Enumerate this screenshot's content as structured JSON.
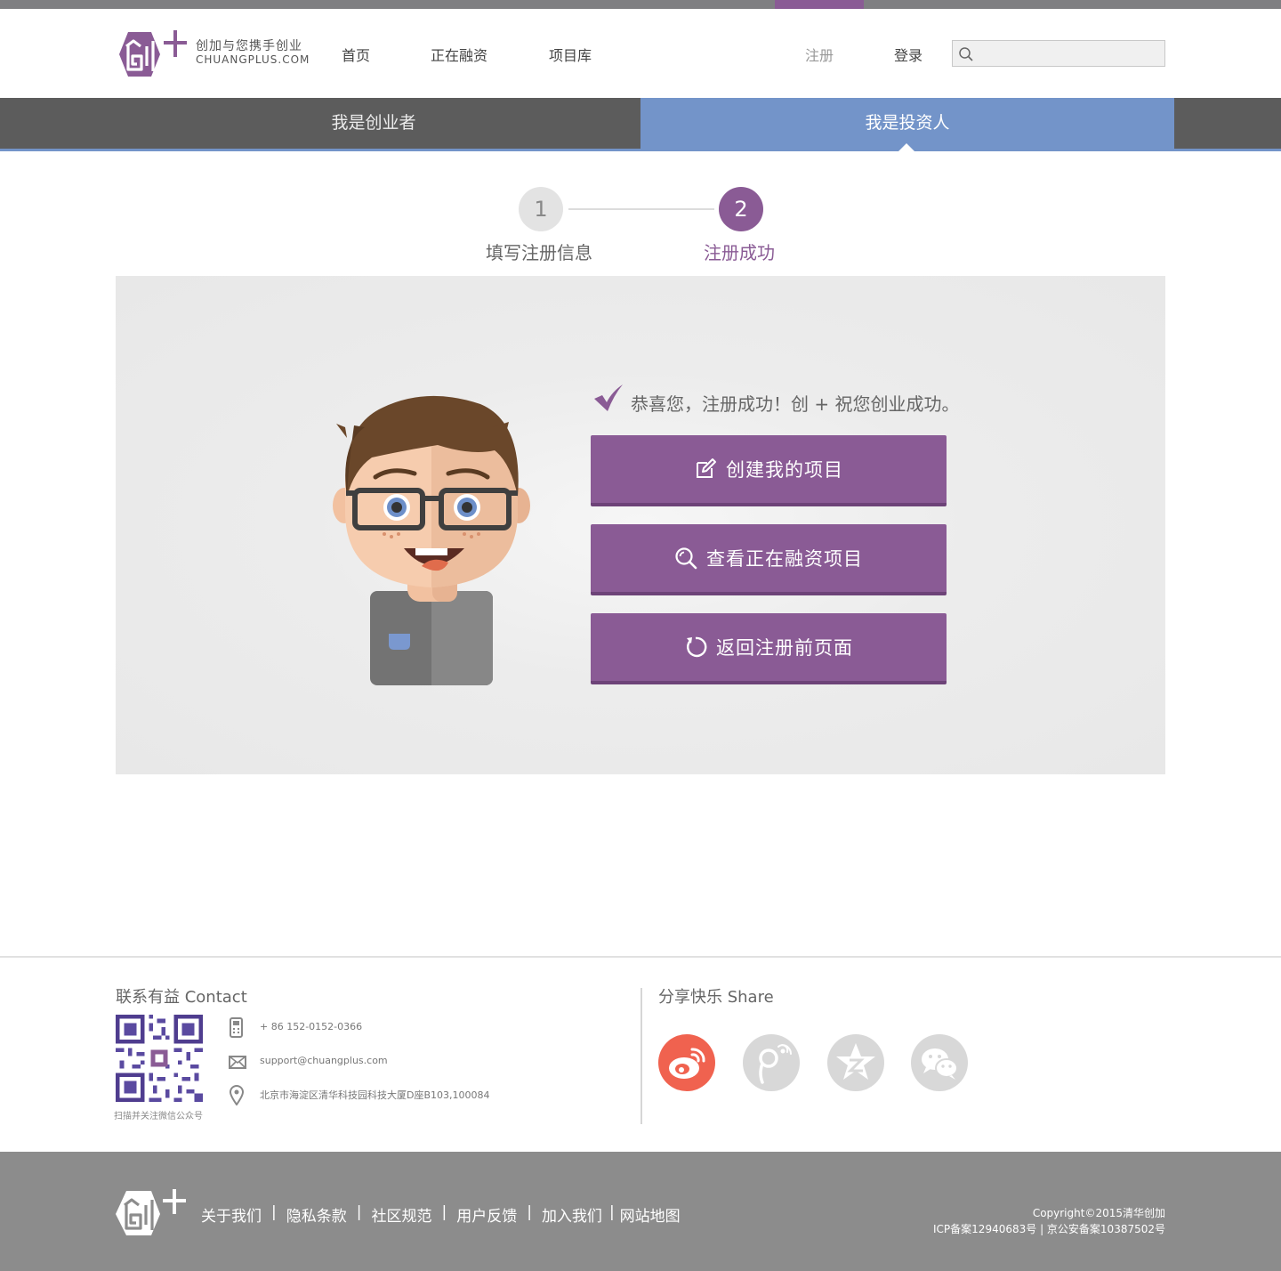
{
  "header": {
    "logo_slogan": "创加与您携手创业",
    "logo_domain": "CHUANGPLUS.COM",
    "nav": [
      "首页",
      "正在融资",
      "项目库"
    ],
    "register": "注册",
    "login": "登录",
    "search_placeholder": ""
  },
  "tabs": {
    "founder": "我是创业者",
    "investor": "我是投资人",
    "active": "investor"
  },
  "steps": {
    "step1_number": "1",
    "step1_label": "填写注册信息",
    "step2_number": "2",
    "step2_label": "注册成功",
    "current": 2
  },
  "success": {
    "message": "恭喜您，注册成功！创 + 祝您创业成功。",
    "buttons": {
      "create": "创建我的项目",
      "view": "查看正在融资项目",
      "back": "返回注册前页面"
    }
  },
  "footer": {
    "contact_title": "联系有益 Contact",
    "qr_caption": "扫描并关注微信公众号",
    "phone": "+ 86 152-0152-0366",
    "email": "support@chuangplus.com",
    "address": "北京市海淀区清华科技园科技大厦D座B103,100084",
    "share_title": "分享快乐 Share",
    "share_icons": [
      "weibo-icon",
      "tencent-weibo-icon",
      "qzone-icon",
      "wechat-icon"
    ]
  },
  "bottom": {
    "links": [
      "关于我们",
      "隐私条款",
      "社区规范",
      "用户反馈",
      "加入我们",
      "网站地图"
    ],
    "separator": "|",
    "copyright": "Copyright©2015清华创加",
    "icp": "ICP备案12940683号 | 京公安备案10387502号"
  },
  "colors": {
    "brand_purple": "#8a5b95",
    "tab_blue": "#7394c9",
    "tab_gray": "#5c5c5c",
    "weibo_red": "#f0624f",
    "footer_gray": "#8c8c8c"
  }
}
